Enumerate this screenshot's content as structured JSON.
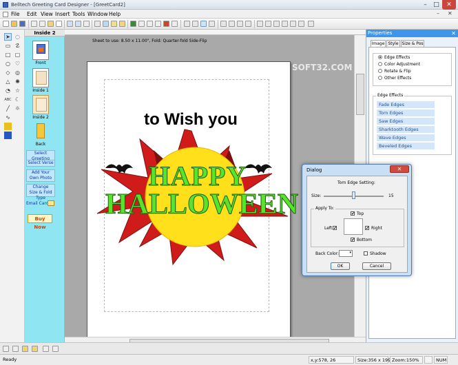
{
  "window": {
    "title": "Belltech Greeting Card Designer - [GreetCard2]",
    "minimize": "–",
    "maximize": "□",
    "close": "✕"
  },
  "menu": {
    "items": [
      "File",
      "Edit",
      "View",
      "Insert",
      "Tools",
      "Window",
      "Help"
    ],
    "mdi_minimize": "–",
    "mdi_close": "✕"
  },
  "pages_panel": {
    "header": "Inside 2",
    "pages": [
      {
        "label": "Front"
      },
      {
        "label": "Inside 1"
      },
      {
        "label": "Inside 2"
      },
      {
        "label": "Back"
      }
    ],
    "actions": [
      "Select Greeting",
      "Select Verse",
      "Add Your Own Photo",
      "Change Size & Fold Type"
    ],
    "email_card": "Email Card",
    "buy_now": "Buy Now"
  },
  "canvas": {
    "sheet_info": "Sheet to use: 8.50 x 11.00\", Fold: Quarter-fold Side-Flip",
    "greeting_text": "to Wish you",
    "art_line1": "HAPPY",
    "art_line2": "HALLOWEEN"
  },
  "properties": {
    "header": "Properties",
    "close": "✕",
    "tabs": [
      "Image",
      "Style",
      "Size & Pos"
    ],
    "active_tab": "Image",
    "options": [
      "Edge Effects",
      "Color Adjustment",
      "Rotate & Flip",
      "Other Effects"
    ],
    "selected_option": "Edge Effects",
    "edge_group_title": "Edge Effects",
    "edge_effects": [
      "Fade Edges",
      "Torn Edges",
      "Saw Edges",
      "Sharktooth Edges",
      "Wave Edges",
      "Beveled Edges"
    ]
  },
  "dialog": {
    "title": "Dialog",
    "close": "✕",
    "setting_title": "Torn Edge Setting:",
    "size_label": "Size:",
    "size_value": "15",
    "size_level": 0.5,
    "apply_to_label": "Apply To:",
    "top": "Top",
    "left": "Left",
    "right": "Right",
    "bottom": "Bottom",
    "back_color_label": "Back Color:",
    "shadow_label": "Shadow",
    "ok": "OK",
    "cancel": "Cancel",
    "check_mark": "✔"
  },
  "status": {
    "ready": "Ready",
    "coords": "x,y:578, 26",
    "size": "Size:356 x 199",
    "zoom": "Zoom:150%",
    "num": "NUM"
  },
  "colors": {
    "panel_cyan": "#8fe6f2",
    "accent_blue": "#3d95ec",
    "pumpkin_yellow": "#ffe01a",
    "burst_red": "#d01b1b",
    "burst_dark": "#7a1010",
    "letter_green": "#5ae32c"
  },
  "watermark": "SOFT32.COM"
}
